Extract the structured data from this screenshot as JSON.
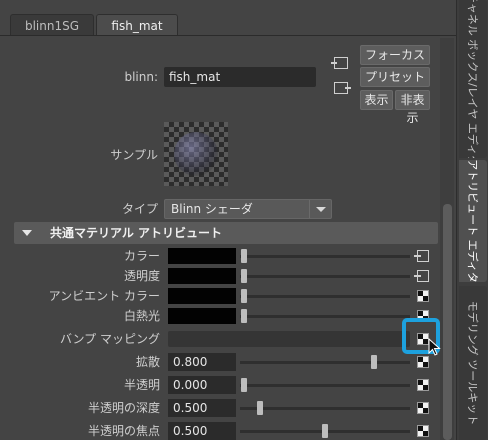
{
  "tabs": [
    {
      "label": "blinn1SG",
      "active": false
    },
    {
      "label": "fish_mat",
      "active": true
    }
  ],
  "side_tabs": [
    {
      "label": "チャネル ボックス/レイヤ エディタ",
      "active": false
    },
    {
      "label": "アトリビュート エディタ",
      "active": true
    },
    {
      "label": "モデリング ツールキット",
      "active": false
    }
  ],
  "node": {
    "type_label": "blinn:",
    "name": "fish_mat"
  },
  "buttons": {
    "focus": "フォーカス",
    "presets": "プリセット",
    "show": "表示",
    "hide": "非表示"
  },
  "sample_label": "サンプル",
  "type_row": {
    "label": "タイプ",
    "value": "Blinn シェーダ"
  },
  "section": {
    "title": "共通マテリアル アトリビュート",
    "expanded": true
  },
  "attributes": [
    {
      "label": "カラー",
      "kind": "color",
      "slider": 0.0,
      "button": "connected"
    },
    {
      "label": "透明度",
      "kind": "color",
      "slider": 0.0,
      "button": "connected"
    },
    {
      "label": "アンビエント カラー",
      "kind": "color",
      "slider": 0.0,
      "button": "map"
    },
    {
      "label": "白熱光",
      "kind": "color",
      "slider": 0.0,
      "button": "map"
    },
    {
      "label": "バンプ マッピング",
      "kind": "bump",
      "button": "map"
    },
    {
      "label": "拡散",
      "kind": "number",
      "value": "0.800",
      "slider": 0.8,
      "button": "map"
    },
    {
      "label": "半透明",
      "kind": "number",
      "value": "0.000",
      "slider": 0.0,
      "button": "map"
    },
    {
      "label": "半透明の深度",
      "kind": "number",
      "value": "0.500",
      "slider": 0.1,
      "button": "map"
    },
    {
      "label": "半透明の焦点",
      "kind": "number",
      "value": "0.500",
      "slider": 0.5,
      "button": "map"
    }
  ],
  "colors": {
    "panel_bg": "#444444",
    "section_header": "#5a5a5a",
    "highlight": "#1da1de"
  }
}
